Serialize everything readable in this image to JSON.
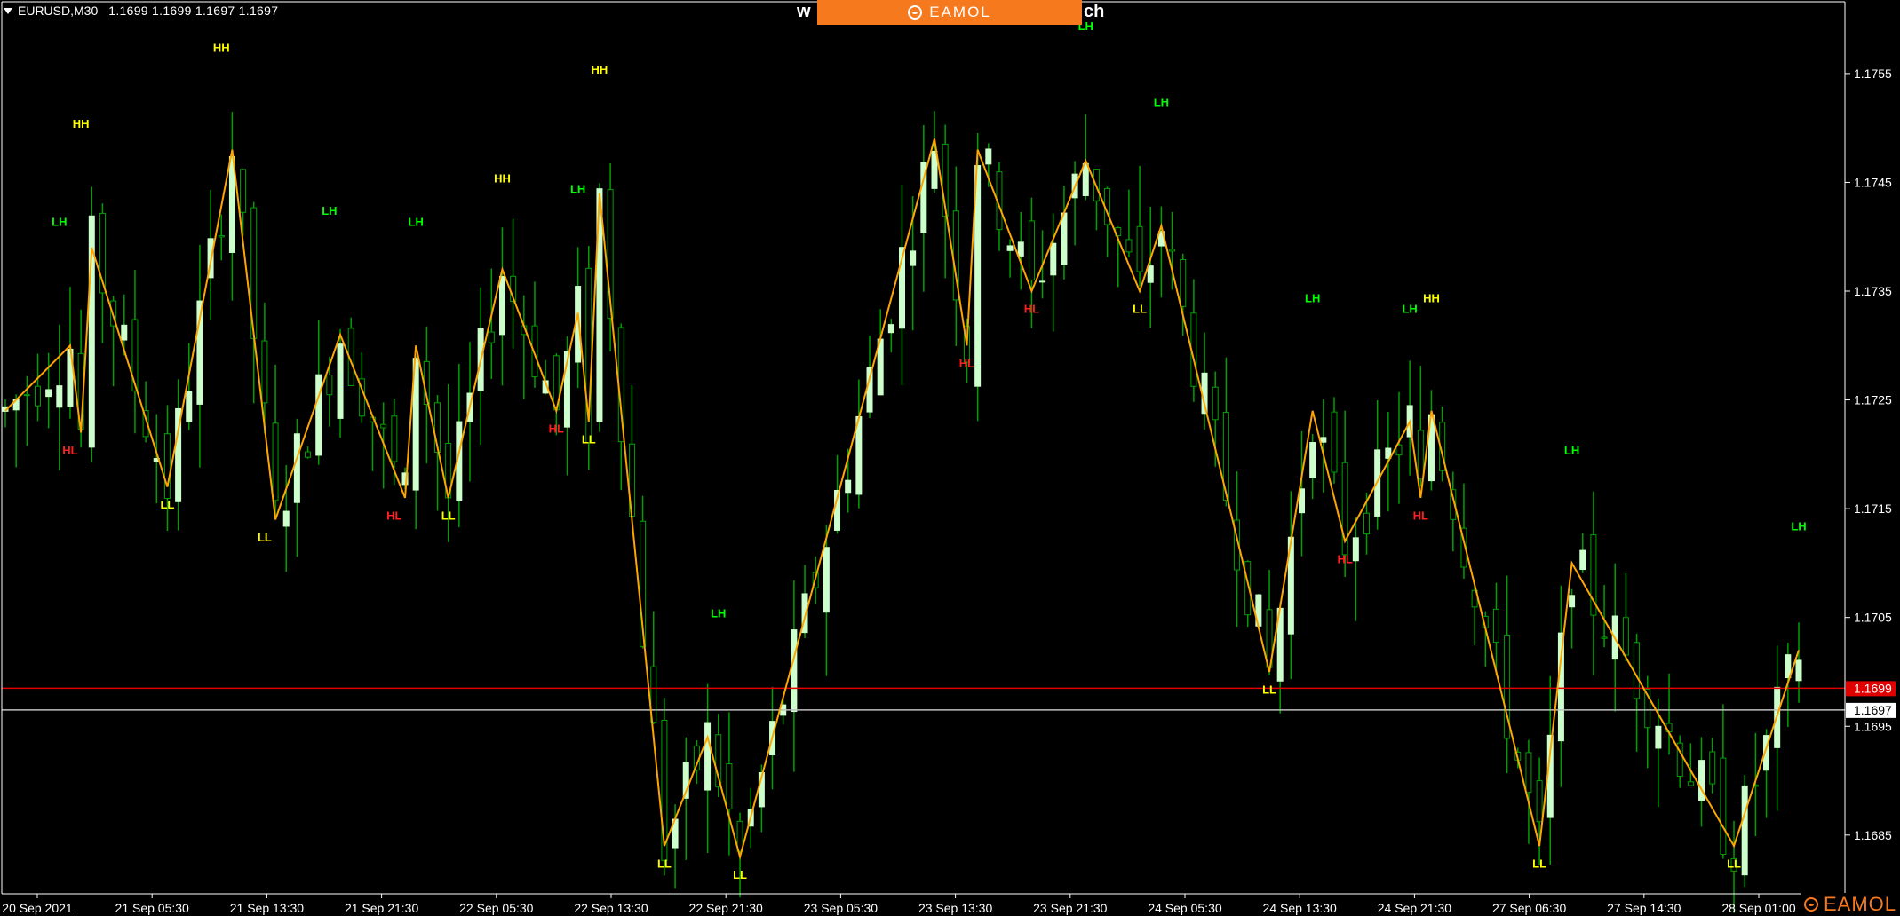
{
  "header": {
    "symbol": "EURUSD,M30",
    "quote": "1.1699 1.1699 1.1697 1.1697",
    "watermark_left": "w",
    "watermark_right": "ch",
    "banner_logo": "EAMOL"
  },
  "footer": {
    "corner_logo": "EAMOL"
  },
  "colors": {
    "background": "#000000",
    "axis": "#ffffff",
    "candle_up": "#ccffcc",
    "candle_down": "#00a000",
    "zigzag": "#ffa500",
    "bid_line": "#e00000",
    "ask_line": "#c0c0c0",
    "label_HH": "#ffff00",
    "label_LL": "#ffff00",
    "label_LH": "#00ff00",
    "label_HL": "#ff2020",
    "banner": "#f7791e"
  },
  "chart_data": {
    "type": "candlestick",
    "symbol": "EURUSD",
    "timeframe": "M30",
    "x_labels": [
      "20 Sep 2021",
      "21 Sep 05:30",
      "21 Sep 13:30",
      "21 Sep 21:30",
      "22 Sep 05:30",
      "22 Sep 13:30",
      "22 Sep 21:30",
      "23 Sep 05:30",
      "23 Sep 13:30",
      "23 Sep 21:30",
      "24 Sep 05:30",
      "24 Sep 13:30",
      "24 Sep 21:30",
      "27 Sep 06:30",
      "27 Sep 14:30",
      "28 Sep 01:00"
    ],
    "x_range": [
      0,
      158
    ],
    "y_ticks": [
      "1.1755",
      "1.1745",
      "1.1735",
      "1.1725",
      "1.1715",
      "1.1705",
      "1.1695",
      "1.1685"
    ],
    "ylim": [
      1.16796,
      1.17616
    ],
    "current_bid": "1.1699",
    "current_ask": "1.1697",
    "bid": 1.16985,
    "ask": 1.16965,
    "zigzag": [
      {
        "x": 0,
        "y": 1.1724
      },
      {
        "x": 6,
        "y": 1.173
      },
      {
        "x": 7,
        "y": 1.1722
      },
      {
        "x": 8,
        "y": 1.1739
      },
      {
        "x": 15,
        "y": 1.1717
      },
      {
        "x": 21,
        "y": 1.1748
      },
      {
        "x": 25,
        "y": 1.1714
      },
      {
        "x": 31,
        "y": 1.1731
      },
      {
        "x": 37,
        "y": 1.1716
      },
      {
        "x": 38,
        "y": 1.173
      },
      {
        "x": 41,
        "y": 1.1716
      },
      {
        "x": 46,
        "y": 1.1737
      },
      {
        "x": 51,
        "y": 1.1724
      },
      {
        "x": 53,
        "y": 1.1733
      },
      {
        "x": 54,
        "y": 1.1723
      },
      {
        "x": 55,
        "y": 1.1744
      },
      {
        "x": 61,
        "y": 1.1684
      },
      {
        "x": 65,
        "y": 1.1694
      },
      {
        "x": 68,
        "y": 1.1683
      },
      {
        "x": 86,
        "y": 1.1749
      },
      {
        "x": 89,
        "y": 1.173
      },
      {
        "x": 90,
        "y": 1.1748
      },
      {
        "x": 95,
        "y": 1.1735
      },
      {
        "x": 100,
        "y": 1.1747
      },
      {
        "x": 105,
        "y": 1.1735
      },
      {
        "x": 107,
        "y": 1.1741
      },
      {
        "x": 117,
        "y": 1.17
      },
      {
        "x": 121,
        "y": 1.1724
      },
      {
        "x": 124,
        "y": 1.1712
      },
      {
        "x": 130,
        "y": 1.1723
      },
      {
        "x": 131,
        "y": 1.1716
      },
      {
        "x": 132,
        "y": 1.1724
      },
      {
        "x": 142,
        "y": 1.1684
      },
      {
        "x": 145,
        "y": 1.171
      },
      {
        "x": 160,
        "y": 1.1684
      },
      {
        "x": 166,
        "y": 1.1702
      }
    ],
    "swing_labels": [
      {
        "text": "LH",
        "x": 5,
        "y": 1.1741
      },
      {
        "text": "HH",
        "x": 7,
        "y": 1.175
      },
      {
        "text": "HL",
        "x": 6,
        "y": 1.172
      },
      {
        "text": "LL",
        "x": 15,
        "y": 1.1715
      },
      {
        "text": "HH",
        "x": 20,
        "y": 1.1757
      },
      {
        "text": "LL",
        "x": 24,
        "y": 1.1712
      },
      {
        "text": "LH",
        "x": 30,
        "y": 1.1742
      },
      {
        "text": "HL",
        "x": 36,
        "y": 1.1714
      },
      {
        "text": "LH",
        "x": 38,
        "y": 1.1741
      },
      {
        "text": "LL",
        "x": 41,
        "y": 1.1714
      },
      {
        "text": "HH",
        "x": 46,
        "y": 1.1745
      },
      {
        "text": "HL",
        "x": 51,
        "y": 1.1722
      },
      {
        "text": "LL",
        "x": 54,
        "y": 1.1721
      },
      {
        "text": "LH",
        "x": 53,
        "y": 1.1744
      },
      {
        "text": "HH",
        "x": 55,
        "y": 1.1755
      },
      {
        "text": "LH",
        "x": 66,
        "y": 1.1705
      },
      {
        "text": "LL",
        "x": 61,
        "y": 1.1682
      },
      {
        "text": "LL",
        "x": 68,
        "y": 1.1681
      },
      {
        "text": "HL",
        "x": 89,
        "y": 1.1728
      },
      {
        "text": "HL",
        "x": 95,
        "y": 1.1733
      },
      {
        "text": "LH",
        "x": 100,
        "y": 1.1759
      },
      {
        "text": "LL",
        "x": 105,
        "y": 1.1733
      },
      {
        "text": "LH",
        "x": 107,
        "y": 1.1752
      },
      {
        "text": "LL",
        "x": 117,
        "y": 1.1698
      },
      {
        "text": "LH",
        "x": 121,
        "y": 1.1734
      },
      {
        "text": "HL",
        "x": 124,
        "y": 1.171
      },
      {
        "text": "HL",
        "x": 131,
        "y": 1.1714
      },
      {
        "text": "LH",
        "x": 130,
        "y": 1.1733
      },
      {
        "text": "HH",
        "x": 132,
        "y": 1.1734
      },
      {
        "text": "LL",
        "x": 142,
        "y": 1.1682
      },
      {
        "text": "LH",
        "x": 145,
        "y": 1.172
      },
      {
        "text": "LL",
        "x": 160,
        "y": 1.1682
      },
      {
        "text": "LH",
        "x": 166,
        "y": 1.1713
      }
    ],
    "grid": false,
    "legend": "none"
  }
}
